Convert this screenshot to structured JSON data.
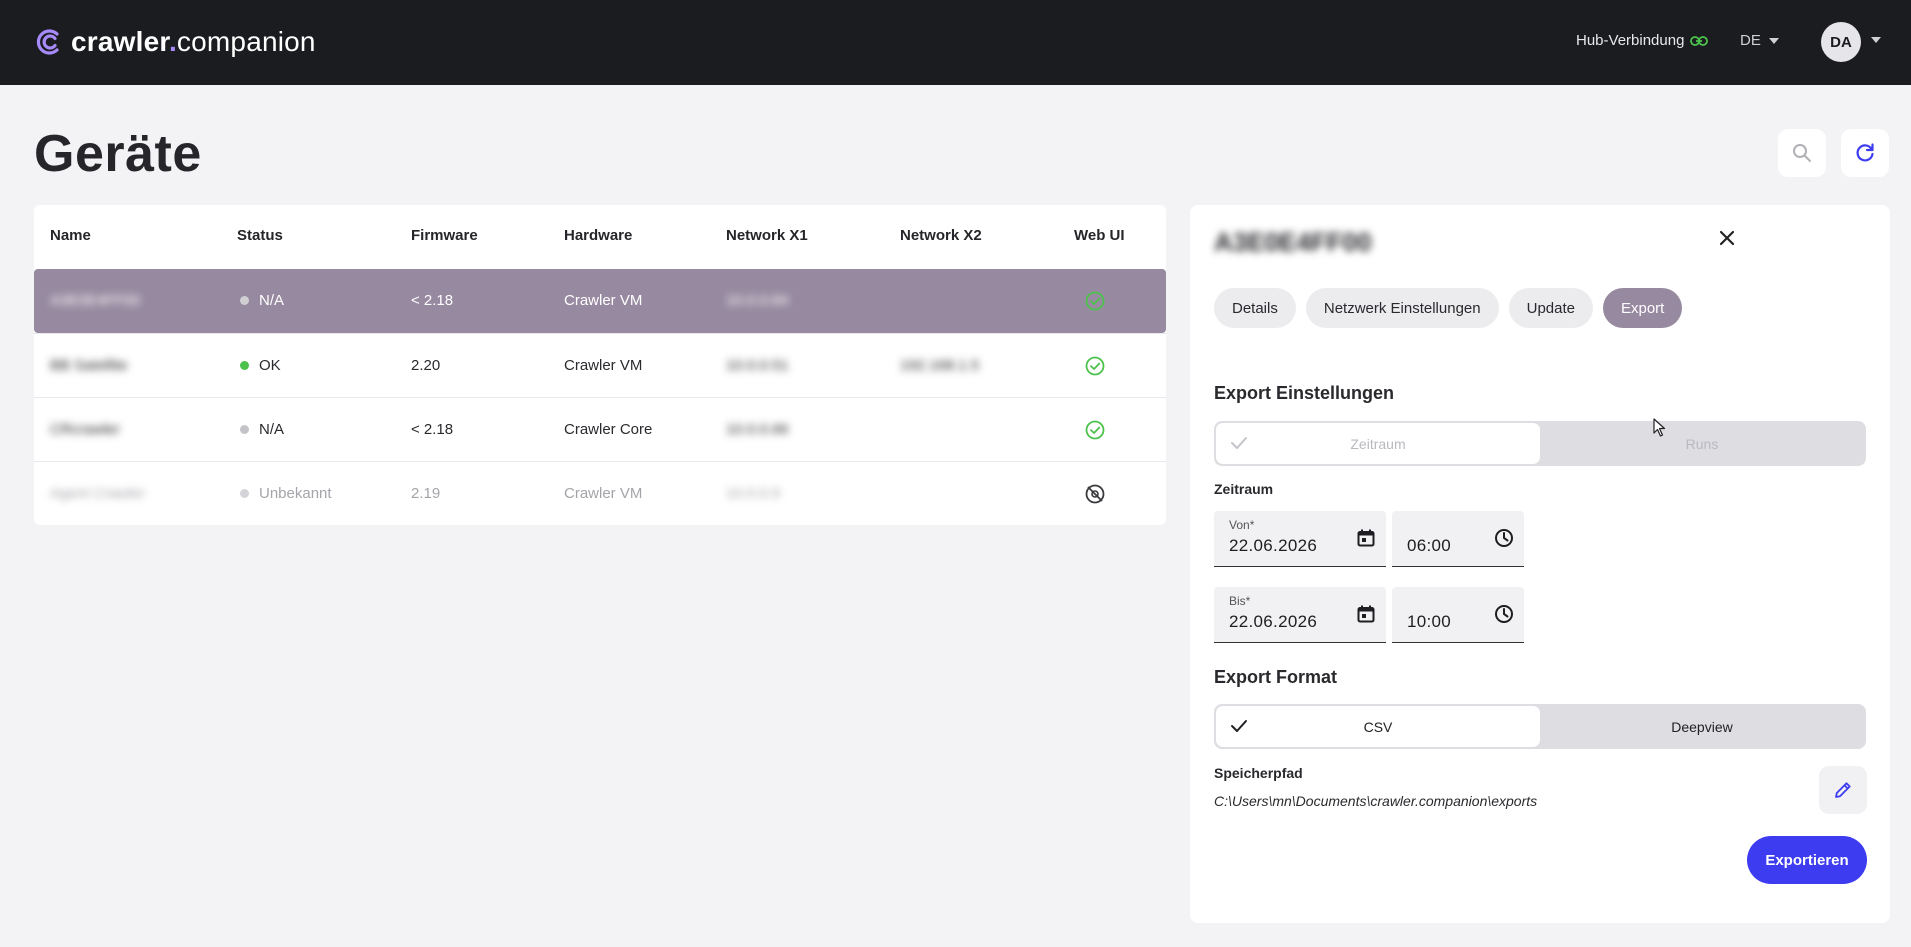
{
  "app": {
    "name_main": "crawler",
    "name_dot": ".",
    "name_rest": "companion",
    "hub_label": "Hub-Verbindung",
    "language": "DE",
    "user_initials": "DA"
  },
  "page": {
    "title": "Geräte"
  },
  "table": {
    "columns": [
      "Name",
      "Status",
      "Firmware",
      "Hardware",
      "Network X1",
      "Network X2",
      "Web UI"
    ],
    "rows": [
      {
        "name": "A3E0E4FF00",
        "status": "N/A",
        "status_color": "#d0d0d4",
        "firmware": "< 2.18",
        "hardware": "Crawler VM",
        "x1": "10.0.0.84",
        "x2": "",
        "webui": "ok",
        "selected": true
      },
      {
        "name": "BB Satellite",
        "status": "OK",
        "status_color": "#4cc24c",
        "firmware": "2.20",
        "hardware": "Crawler VM",
        "x1": "10.0.0.51",
        "x2": "192.168.1.5",
        "webui": "ok",
        "selected": false
      },
      {
        "name": "CRcrawler",
        "status": "N/A",
        "status_color": "#c4c4c8",
        "firmware": "< 2.18",
        "hardware": "Crawler Core",
        "x1": "10.0.0.66",
        "x2": "",
        "webui": "ok",
        "selected": false
      },
      {
        "name": "Agent Crawler",
        "status": "Unbekannt",
        "status_color": "#d4d4d8",
        "firmware": "2.19",
        "hardware": "Crawler VM",
        "x1": "10.0.0.9",
        "x2": "",
        "webui": "off",
        "selected": false
      }
    ]
  },
  "panel": {
    "device_name": "A3E0E4FF00",
    "tabs": [
      "Details",
      "Netzwerk Einstellungen",
      "Update",
      "Export"
    ],
    "active_tab": "Export",
    "export_settings_title": "Export Einstellungen",
    "mode_options": [
      "Zeitraum",
      "Runs"
    ],
    "zeitraum_label": "Zeitraum",
    "from_label": "Von*",
    "from_date": "22.06.2026",
    "from_time": "06:00",
    "to_label": "Bis*",
    "to_date": "22.06.2026",
    "to_time": "10:00",
    "format_title": "Export Format",
    "format_options": [
      "CSV",
      "Deepview"
    ],
    "path_label": "Speicherpfad",
    "path_value": "C:\\Users\\mn\\Documents\\crawler.companion\\exports",
    "export_button": "Exportieren"
  },
  "colors": {
    "accent": "#3d3cf0",
    "selected_row": "#978aa0",
    "topbar": "#1b1c20",
    "success": "#4cc24c"
  }
}
